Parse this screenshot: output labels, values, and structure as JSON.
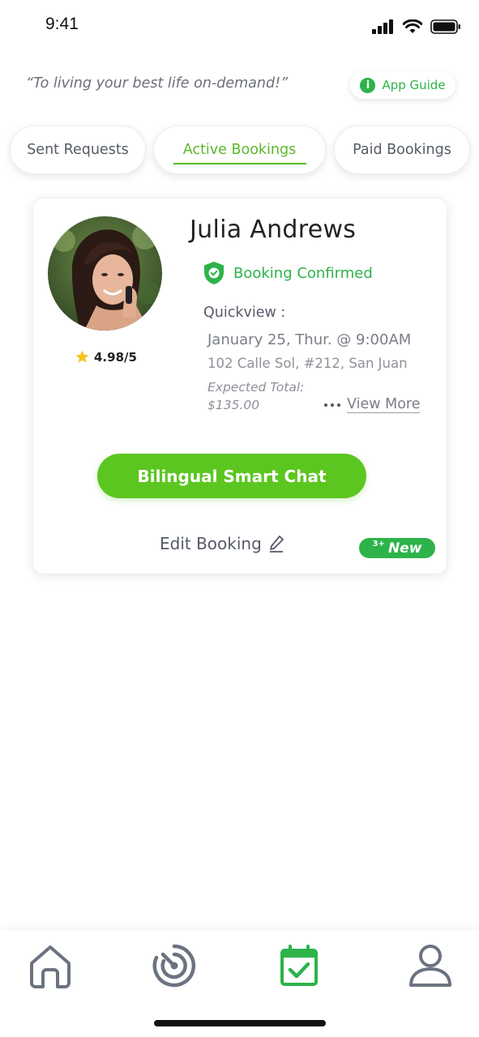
{
  "status_bar": {
    "time": "9:41"
  },
  "header": {
    "tagline": "“To living your best life on-demand!”",
    "app_guide_label": "App Guide"
  },
  "tabs": [
    {
      "label": "Sent Requests"
    },
    {
      "label": "Active Bookings",
      "active": true
    },
    {
      "label": "Paid Bookings"
    }
  ],
  "booking": {
    "name": "Julia Andrews",
    "rating": "4.98/5",
    "status": "Booking Confirmed",
    "quickview_label": "Quickview :",
    "datetime": "January 25, Thur. @ 9:00AM",
    "address": "102 Calle Sol, #212, San Juan",
    "expected_total_label": "Expected Total:",
    "expected_total_value": "$135.00",
    "view_more_label": "View More",
    "chat_button_label": "Bilingual Smart Chat",
    "edit_label": "Edit Booking",
    "new_badge_count": "3+",
    "new_badge_label": "New"
  },
  "bottom_nav": [
    {
      "icon": "home-icon"
    },
    {
      "icon": "radar-icon"
    },
    {
      "icon": "calendar-check-icon",
      "active": true
    },
    {
      "icon": "profile-icon"
    }
  ],
  "colors": {
    "accent_green": "#5cc620",
    "status_green": "#2db34a",
    "text_gray": "#555b66"
  }
}
